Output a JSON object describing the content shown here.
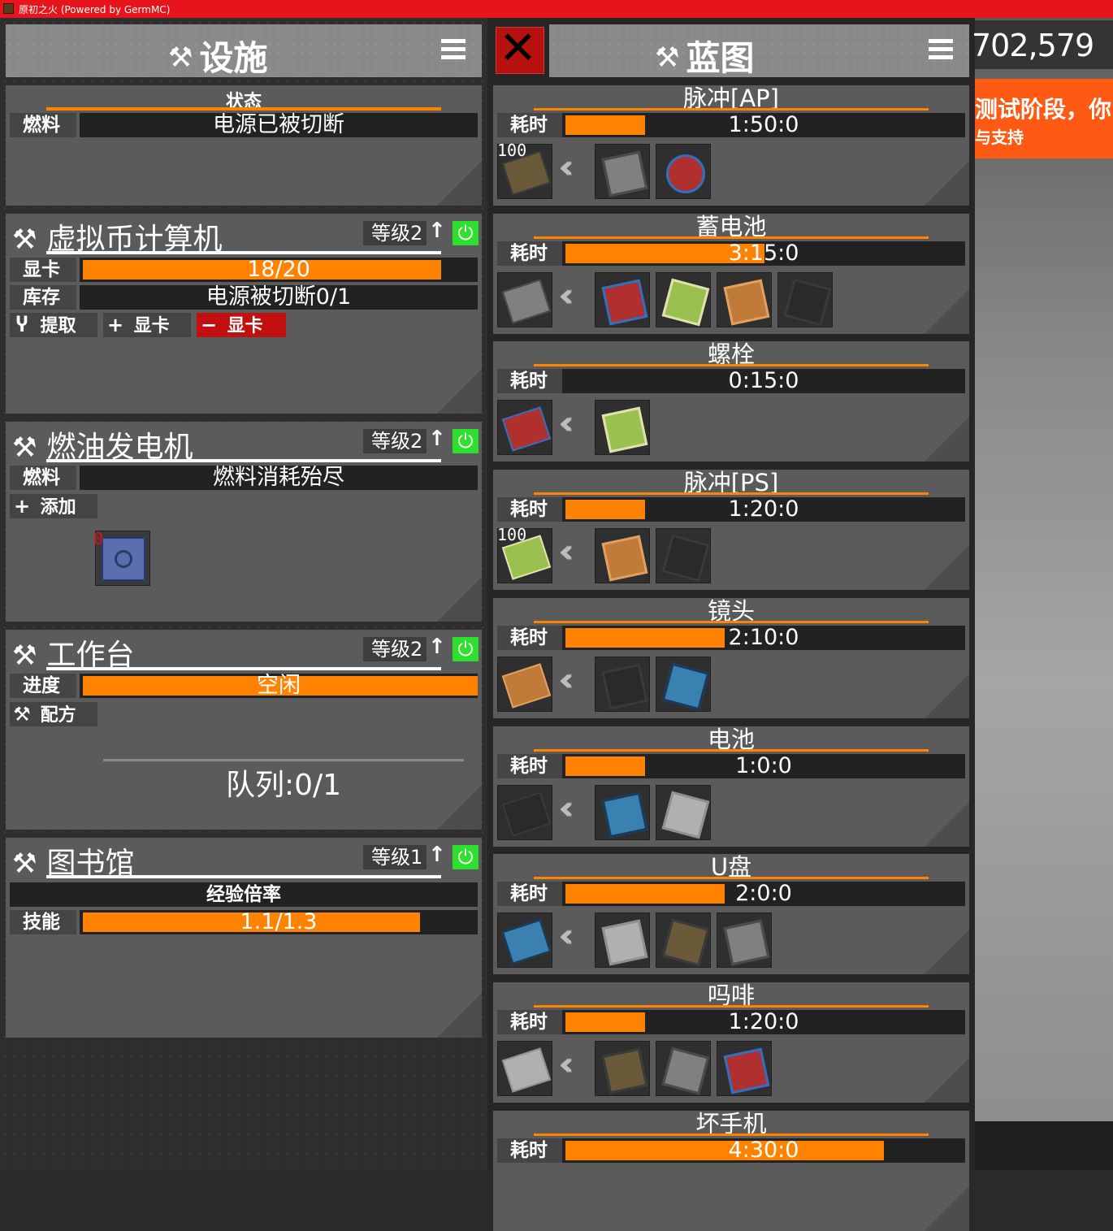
{
  "window": {
    "title": "原初之火 (Powered by GermMC)"
  },
  "hud": {
    "money": "702,579",
    "banner_line1": "测试阶段，你",
    "banner_line2": "与支持"
  },
  "facilities": {
    "title": "设施",
    "status_panel": {
      "heading": "状态",
      "fuel_label": "燃料",
      "fuel_value": "电源已被切断"
    },
    "crypto_computer": {
      "title": "虚拟币计算机",
      "level": "等级2",
      "gpu_label": "显卡",
      "gpu_value": "18/20",
      "gpu_fraction": 0.9,
      "storage_label": "库存",
      "storage_value": "电源被切断0/1",
      "btn_extract": "提取",
      "btn_add_gpu": "显卡",
      "btn_remove_gpu": "显卡"
    },
    "fuel_generator": {
      "title": "燃油发电机",
      "level": "等级2",
      "fuel_label": "燃料",
      "fuel_value": "燃料消耗殆尽",
      "btn_add": "添加",
      "slot_count": "0"
    },
    "workbench": {
      "title": "工作台",
      "level": "等级2",
      "progress_label": "进度",
      "progress_value": "空闲",
      "progress_fraction": 1.0,
      "btn_recipe": "配方",
      "queue": "队列:0/1"
    },
    "library": {
      "title": "图书馆",
      "level": "等级1",
      "exp_rate": "经验倍率",
      "skill_label": "技能",
      "skill_value": "1.1/1.3",
      "skill_fraction": 0.846
    }
  },
  "blueprints": {
    "title": "蓝图",
    "time_label": "耗时",
    "items": [
      {
        "name": "脉冲[AP]",
        "time": "1:50:0",
        "fill": 0.2,
        "count": "100",
        "inputs": 2
      },
      {
        "name": "蓄电池",
        "time": "3:15:0",
        "fill": 0.5,
        "count": "",
        "inputs": 4
      },
      {
        "name": "螺栓",
        "time": "0:15:0",
        "fill": 0.0,
        "count": "",
        "inputs": 1
      },
      {
        "name": "脉冲[PS]",
        "time": "1:20:0",
        "fill": 0.2,
        "count": "100",
        "inputs": 2
      },
      {
        "name": "镜头",
        "time": "2:10:0",
        "fill": 0.4,
        "count": "",
        "inputs": 2
      },
      {
        "name": "电池",
        "time": "1:0:0",
        "fill": 0.2,
        "count": "",
        "inputs": 2
      },
      {
        "name": "U盘",
        "time": "2:0:0",
        "fill": 0.4,
        "count": "",
        "inputs": 3
      },
      {
        "name": "吗啡",
        "time": "1:20:0",
        "fill": 0.2,
        "count": "",
        "inputs": 3
      },
      {
        "name": "坏手机",
        "time": "4:30:0",
        "fill": 0.8,
        "count": "",
        "inputs": 0
      }
    ]
  },
  "colors": {
    "accent": "#ff8200",
    "header_red": "#e8141c",
    "power_green": "#2ee02e",
    "danger": "#c21010"
  }
}
